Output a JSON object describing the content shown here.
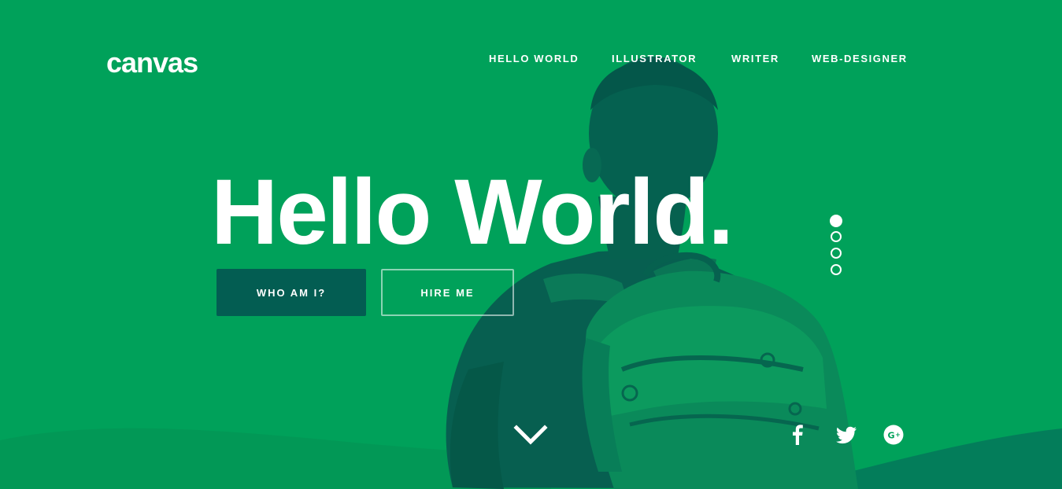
{
  "brand": {
    "logo": "canvas"
  },
  "nav": {
    "items": [
      {
        "label": "HELLO WORLD"
      },
      {
        "label": "ILLUSTRATOR"
      },
      {
        "label": "WRITER"
      },
      {
        "label": "WEB-DESIGNER"
      }
    ]
  },
  "hero": {
    "headline": "Hello World.",
    "primary_button": "WHO AM I?",
    "secondary_button": "HIRE ME",
    "slider_dots": 4,
    "active_dot": 1
  },
  "icons": {
    "scroll": "chevron-down-icon",
    "social": [
      "facebook-icon",
      "twitter-icon",
      "google-plus-icon"
    ]
  },
  "colors": {
    "background": "#00a15a",
    "overlay_dark": "#035d52",
    "text": "#ffffff"
  }
}
